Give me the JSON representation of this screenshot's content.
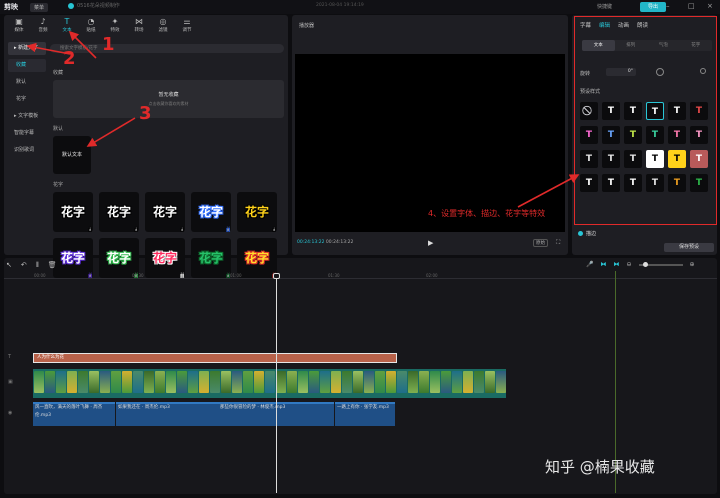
{
  "titlebar": {
    "app_name": "剪映",
    "menu": "菜单",
    "draft_title": "0516花朵视频制作",
    "draft_time": "2021-08-04 19:14:19",
    "shortcut": "快捷键",
    "export": "导出",
    "controls": [
      "–",
      "□",
      "×"
    ]
  },
  "toolbar": [
    {
      "icon": "media-icon",
      "glyph": "▣",
      "label": "媒体"
    },
    {
      "icon": "audio-icon",
      "glyph": "♪",
      "label": "音频"
    },
    {
      "icon": "text-icon",
      "glyph": "T",
      "label": "文本"
    },
    {
      "icon": "sticker-icon",
      "glyph": "◔",
      "label": "贴纸"
    },
    {
      "icon": "effect-icon",
      "glyph": "✦",
      "label": "特效"
    },
    {
      "icon": "transition-icon",
      "glyph": "⋈",
      "label": "转场"
    },
    {
      "icon": "filter-icon",
      "glyph": "◎",
      "label": "滤镜"
    },
    {
      "icon": "adjust-icon",
      "glyph": "⚌",
      "label": "调节"
    }
  ],
  "side_nav": {
    "new_text": "新建文本",
    "favorites": "收藏",
    "default": "默认",
    "fancy": "花字",
    "templates": "文字模板",
    "smart_caption": "智能字幕",
    "lyrics": "识别歌词"
  },
  "search": {
    "placeholder": "搜索文字模板/花字"
  },
  "sections": {
    "fav": "收藏",
    "default": "默认",
    "fancy": "花字"
  },
  "fav_empty": {
    "title": "暂无收藏",
    "sub": "点击收藏你喜欢的素材"
  },
  "default_text": "默认文本",
  "fancy_items": [
    {
      "text": "花字",
      "color": "#ffffff",
      "stroke": "#000000"
    },
    {
      "text": "花字",
      "color": "#ffffff",
      "stroke": "#000000"
    },
    {
      "text": "花字",
      "color": "#ffffff",
      "stroke": "#000000"
    },
    {
      "text": "花字",
      "color": "#ffffff",
      "stroke": "#2d6cff"
    },
    {
      "text": "花字",
      "color": "#ffd21a",
      "stroke": "#000000"
    },
    {
      "text": "花字",
      "color": "#ffffff",
      "stroke": "#5a2bd8"
    },
    {
      "text": "花字",
      "color": "#ffffff",
      "stroke": "#2db84a"
    },
    {
      "text": "花字",
      "color": "#ff2b5e",
      "stroke": "#ffffff"
    },
    {
      "text": "花字",
      "color": "#26c26a",
      "stroke": "#0d6b2d"
    },
    {
      "text": "花字",
      "color": "#ffde2c",
      "stroke": "#e02a2a"
    }
  ],
  "player": {
    "title": "播放器",
    "current_time": "00:24:13:22",
    "total_time": "00:24:13:22",
    "ratio": "原始",
    "play": "▶",
    "fullscreen": "⛶"
  },
  "right_panel": {
    "tabs": [
      "字幕",
      "编辑",
      "动画",
      "朗读"
    ],
    "active_tab": 1,
    "subtabs": [
      "文本",
      "排列",
      "气泡",
      "花字"
    ],
    "active_subtab": 0,
    "rotation_label": "旋转",
    "rotation_value": "0°",
    "preset_label": "预设样式",
    "presets": [
      {
        "text": "⃠",
        "fg": "#cfcfd4",
        "bg": "#0b0b0d"
      },
      {
        "text": "T",
        "fg": "#ffffff",
        "bg": "#0b0b0d"
      },
      {
        "text": "T",
        "fg": "#ffffff",
        "bg": "#0b0b0d"
      },
      {
        "text": "T",
        "fg": "#ffffff",
        "bg": "#0b0b0d",
        "border": "#29c6d6"
      },
      {
        "text": "T",
        "fg": "#ffffff",
        "bg": "#0b0b0d"
      },
      {
        "text": "T",
        "fg": "#e84a4a",
        "bg": "#0b0b0d"
      },
      {
        "text": "T",
        "fg": "#ff6ad5",
        "bg": "#0b0b0d"
      },
      {
        "text": "T",
        "fg": "#6aa6ff",
        "bg": "#0b0b0d"
      },
      {
        "text": "T",
        "fg": "#c2e84a",
        "bg": "#0b0b0d"
      },
      {
        "text": "T",
        "fg": "#3ad3a0",
        "bg": "#0b0b0d"
      },
      {
        "text": "T",
        "fg": "#ff7ab0",
        "bg": "#0b0b0d"
      },
      {
        "text": "T",
        "fg": "#ff9ac8",
        "bg": "#0b0b0d"
      },
      {
        "text": "T",
        "fg": "#e6e6e6",
        "bg": "#0b0b0d"
      },
      {
        "text": "T",
        "fg": "#e6e6e6",
        "bg": "#0b0b0d"
      },
      {
        "text": "T",
        "fg": "#e6e6e6",
        "bg": "#0b0b0d"
      },
      {
        "text": "T",
        "fg": "#000000",
        "bg": "#ffffff"
      },
      {
        "text": "T",
        "fg": "#000000",
        "bg": "#ffd21a"
      },
      {
        "text": "T",
        "fg": "#ffffff",
        "bg": "#b85a5a"
      },
      {
        "text": "T",
        "fg": "#ffffff",
        "bg": "#0b0b0d"
      },
      {
        "text": "T",
        "fg": "#ffffff",
        "bg": "#0b0b0d"
      },
      {
        "text": "T",
        "fg": "#ffffff",
        "bg": "#0b0b0d"
      },
      {
        "text": "T",
        "fg": "#e6e6e6",
        "bg": "#0b0b0d"
      },
      {
        "text": "T",
        "fg": "#f0a020",
        "bg": "#0b0b0d"
      },
      {
        "text": "T",
        "fg": "#2db84a",
        "bg": "#0b0b0d"
      }
    ],
    "stroke_label": "描边",
    "save_preset": "保存预设"
  },
  "timeline": {
    "ticks": [
      "00:00",
      "00:30",
      "01:00",
      "01:30",
      "02:00"
    ],
    "text_clip": "人为什么为花",
    "video_thumb_colors": [
      "#2f8a4a",
      "#4b9a3a",
      "#1e6e8a",
      "#7fb050",
      "#3c7a2e",
      "#9ac060",
      "#2a5a80",
      "#60a040",
      "#d4b030",
      "#4a8a6a",
      "#3a6a2a",
      "#8ab050"
    ],
    "audio_clips": [
      {
        "label": "风一直吹，满天的落叶飞舞 · 周杰伦.mp3"
      },
      {
        "label": "如果我还在 · 周杰伦.mp3"
      },
      {
        "label": "那些你很冒险的梦 · 林俊杰.mp3"
      },
      {
        "label": "一路上有你 · 张学友.mp3"
      }
    ]
  },
  "annotations": {
    "n1": "1",
    "n2": "2",
    "n3": "3",
    "step4": "4、设置字体、描边、花字等特效",
    "color": "#e02a2a"
  },
  "watermark": "知乎 @楠果收藏"
}
